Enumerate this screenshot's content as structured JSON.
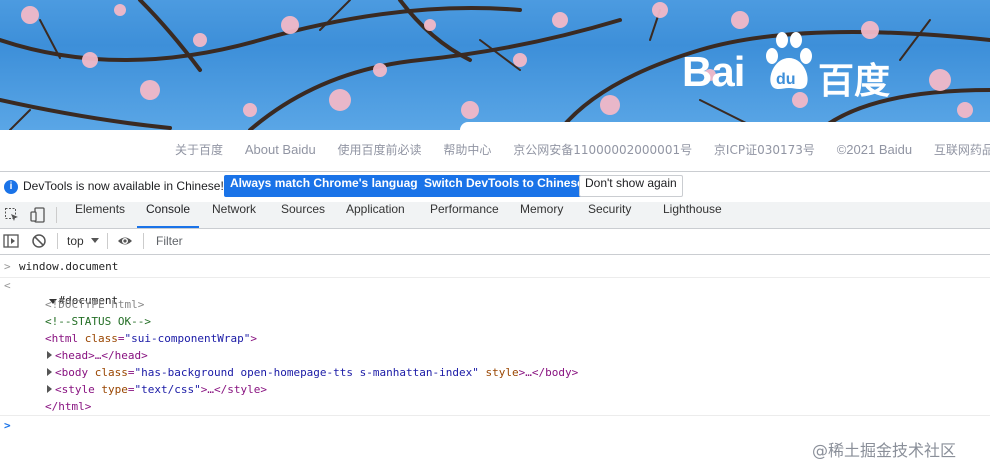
{
  "colors": {
    "sky": "#3d8fd9",
    "accent": "#1a73e8",
    "footer_text": "#9195a3"
  },
  "logo": {
    "bai": "Bai",
    "du": "百度"
  },
  "footer": {
    "links": [
      "关于百度",
      "About Baidu",
      "使用百度前必读",
      "帮助中心",
      "京公网安备11000002000001号",
      "京ICP证030173号",
      "©2021 Baidu",
      "互联网药品信息服"
    ]
  },
  "infobar": {
    "icon": "info-icon",
    "message": "DevTools is now available in Chinese!",
    "btn_match": "Always match Chrome's language",
    "btn_switch": "Switch DevTools to Chinese",
    "btn_dismiss": "Don't show again"
  },
  "tabs": [
    "Elements",
    "Console",
    "Network",
    "Sources",
    "Application",
    "Performance",
    "Memory",
    "Security",
    "Lighthouse"
  ],
  "active_tab": "Console",
  "toolbar": {
    "context": "top",
    "filter_placeholder": "Filter"
  },
  "console": {
    "input_cmd": "window.document",
    "result_root": "#document",
    "doctype": "<!DOCTYPE html>",
    "comment": "<!--STATUS OK-->",
    "html_open_tag": "<html",
    "html_attr": "class",
    "html_val": "\"sui-componentWrap\"",
    "html_close": ">",
    "head_line": "<head>…</head>",
    "body_tag": "<body",
    "body_attr": "class",
    "body_val": "\"has-background open-homepage-tts s-manhattan-index\"",
    "body_attr2": "style",
    "body_end": ">…</body>",
    "style_tag": "<style",
    "style_attr": "type",
    "style_val": "\"text/css\"",
    "style_end": ">…</style>",
    "html_end": "</html>"
  },
  "watermark": "@稀土掘金技术社区"
}
